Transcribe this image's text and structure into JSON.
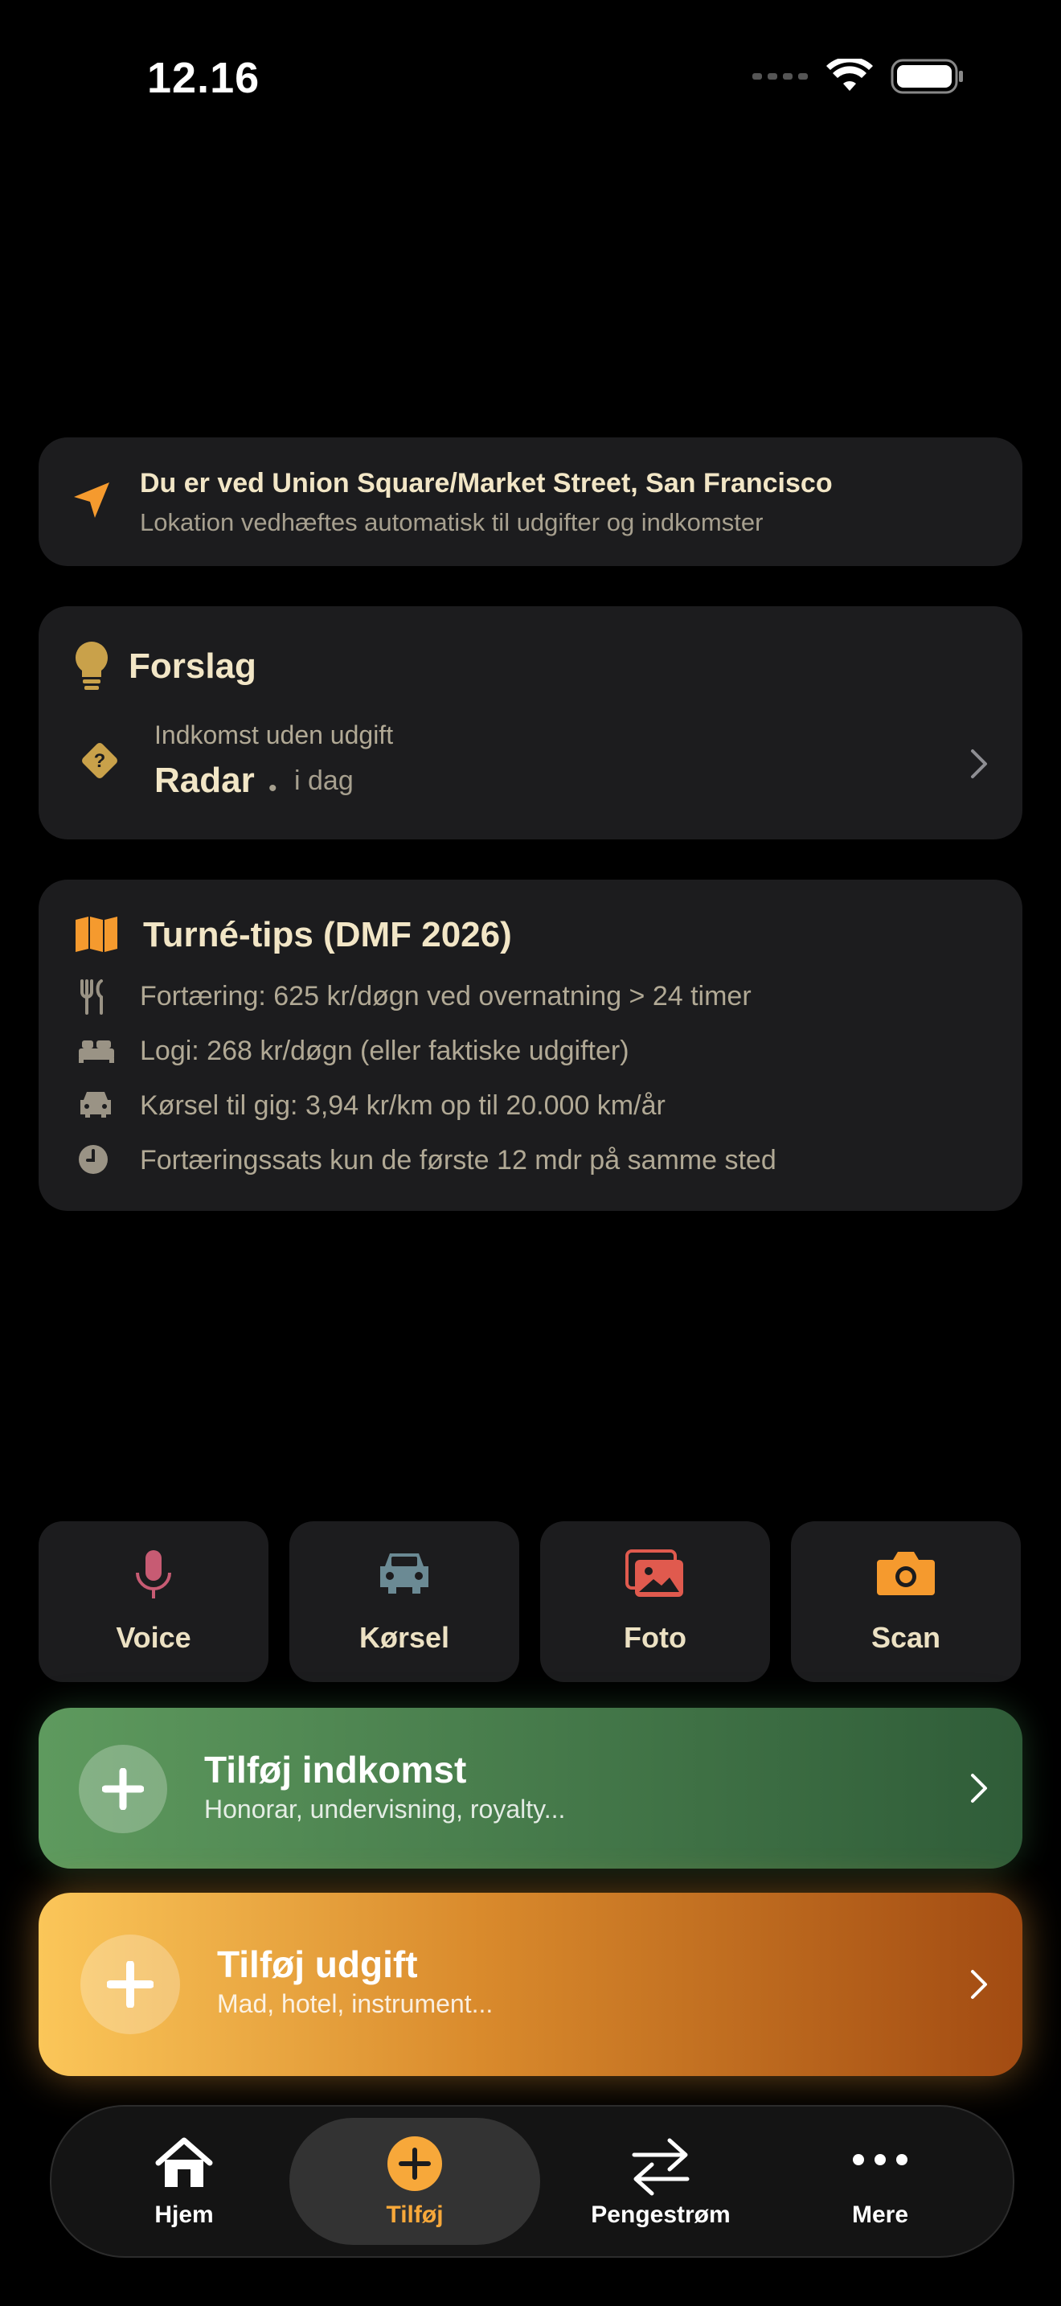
{
  "status_bar": {
    "time": "12.16"
  },
  "location": {
    "title": "Du er ved Union Square/Market Street, San Francisco",
    "subtitle": "Lokation vedhæftes automatisk til udgifter og indkomster"
  },
  "suggestions": {
    "title": "Forslag",
    "item": {
      "category": "Indkomst uden udgift",
      "name": "Radar",
      "separator": "•",
      "date": "i dag"
    }
  },
  "tips": {
    "title": "Turné-tips (DMF 2026)",
    "items": [
      {
        "icon": "fork-knife-icon",
        "text": "Fortæring: 625 kr/døgn ved overnatning > 24 timer"
      },
      {
        "icon": "bed-icon",
        "text": "Logi: 268 kr/døgn (eller faktiske udgifter)"
      },
      {
        "icon": "car-icon",
        "text": "Kørsel til gig: 3,94 kr/km op til 20.000 km/år"
      },
      {
        "icon": "clock-icon",
        "text": "Fortæringssats kun de første 12 mdr på samme sted"
      }
    ]
  },
  "quick_actions": [
    {
      "label": "Voice",
      "icon": "microphone-icon",
      "color": "#c75b73"
    },
    {
      "label": "Kørsel",
      "icon": "car-icon",
      "color": "#6b8a94"
    },
    {
      "label": "Foto",
      "icon": "photos-icon",
      "color": "#e05a4e"
    },
    {
      "label": "Scan",
      "icon": "camera-icon",
      "color": "#f59a2e"
    }
  ],
  "income_button": {
    "title": "Tilføj indkomst",
    "subtitle": "Honorar, undervisning, royalty..."
  },
  "expense_button": {
    "title": "Tilføj udgift",
    "subtitle": "Mad, hotel, instrument..."
  },
  "tab_bar": {
    "tabs": [
      {
        "label": "Hjem",
        "icon": "house-icon"
      },
      {
        "label": "Tilføj",
        "icon": "plus-circle-icon",
        "active": true
      },
      {
        "label": "Pengestrøm",
        "icon": "arrows-icon"
      },
      {
        "label": "Mere",
        "icon": "ellipsis-icon"
      }
    ]
  },
  "colors": {
    "accent": "#f7a83a",
    "card": "#1c1c1e",
    "gold": "#c9a14a"
  }
}
